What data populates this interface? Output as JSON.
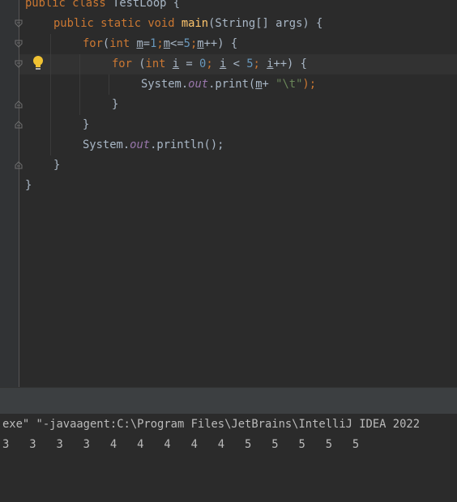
{
  "editor": {
    "line1": {
      "kw1": "public",
      "kw2": "class",
      "name": "TestLoop",
      "brace": "{"
    },
    "line2": {
      "kw1": "public",
      "kw2": "static",
      "kw3": "void",
      "method": "main",
      "params": "(String[] args) {"
    },
    "line3": {
      "kw_for": "for",
      "p1": "(",
      "kw_int": "int",
      "var1": "m",
      "eq1": "=",
      "n1": "1",
      "semi1": ";",
      "var2": "m",
      "lt": "<=",
      "n2": "5",
      "semi2": ";",
      "var3": "m",
      "inc": "++) {"
    },
    "line4": {
      "kw_for": "for",
      "p1": " (",
      "kw_int": "int",
      "var1": "i",
      "eq1": " = ",
      "n1": "0",
      "semi1": "; ",
      "var2": "i",
      "lt": " < ",
      "n2": "5",
      "semi2": "; ",
      "var3": "i",
      "inc": "++) {"
    },
    "line5": {
      "cls": "System.",
      "field": "out",
      "call": ".print(",
      "var": "m",
      "plus": "+ ",
      "str": "\"\\t\"",
      "end": ");"
    },
    "line6": {
      "text": "}"
    },
    "line7": {
      "text": "}"
    },
    "line8": {
      "cls": "System.",
      "field": "out",
      "call": ".println();"
    },
    "line9": {
      "text": "}"
    },
    "line10": {
      "text": "}"
    }
  },
  "console": {
    "command": "exe\" \"-javaagent:C:\\Program Files\\JetBrains\\IntelliJ IDEA 2022",
    "output": "3   3   3   3   4   4   4   4   4   5   5   5   5   5"
  },
  "icons": {
    "bulb": "lightbulb-icon",
    "fold": "fold-marker-icon"
  },
  "colors": {
    "background": "#2b2b2b",
    "keyword": "#cc7832",
    "method": "#ffc66d",
    "number": "#6897bb",
    "string": "#6a8759",
    "field": "#9876aa",
    "text": "#a9b7c6",
    "bulb": "#f0c232"
  }
}
